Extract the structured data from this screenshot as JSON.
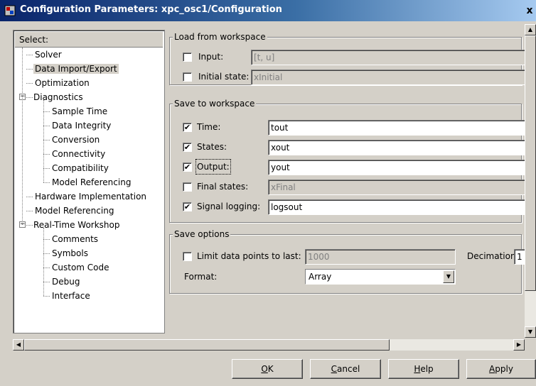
{
  "window": {
    "title": "Configuration Parameters: xpc_osc1/Configuration",
    "close_label": "x"
  },
  "tree": {
    "header": "Select:",
    "items": [
      {
        "label": "Solver",
        "level": 1
      },
      {
        "label": "Data Import/Export",
        "level": 1,
        "selected": true
      },
      {
        "label": "Optimization",
        "level": 1
      },
      {
        "label": "Diagnostics",
        "level": 0,
        "expander": "−"
      },
      {
        "label": "Sample Time",
        "level": 2
      },
      {
        "label": "Data Integrity",
        "level": 2
      },
      {
        "label": "Conversion",
        "level": 2
      },
      {
        "label": "Connectivity",
        "level": 2
      },
      {
        "label": "Compatibility",
        "level": 2
      },
      {
        "label": "Model Referencing",
        "level": 2
      },
      {
        "label": "Hardware Implementation",
        "level": 1
      },
      {
        "label": "Model Referencing",
        "level": 1
      },
      {
        "label": "Real-Time Workshop",
        "level": 0,
        "expander": "−"
      },
      {
        "label": "Comments",
        "level": 2
      },
      {
        "label": "Symbols",
        "level": 2
      },
      {
        "label": "Custom Code",
        "level": 2
      },
      {
        "label": "Debug",
        "level": 2
      },
      {
        "label": "Interface",
        "level": 2
      }
    ]
  },
  "load": {
    "title": "Load from workspace",
    "input": {
      "label": "Input:",
      "checked": false,
      "value": "[t, u]"
    },
    "initial_state": {
      "label": "Initial state:",
      "checked": false,
      "value": "xInitial"
    }
  },
  "save": {
    "title": "Save to workspace",
    "time": {
      "label": "Time:",
      "checked": true,
      "value": "tout"
    },
    "states": {
      "label": "States:",
      "checked": true,
      "value": "xout"
    },
    "output": {
      "label": "Output:",
      "checked": true,
      "value": "yout"
    },
    "final_states": {
      "label": "Final states:",
      "checked": false,
      "value": "xFinal"
    },
    "signal_logging": {
      "label": "Signal logging:",
      "checked": true,
      "value": "logsout"
    }
  },
  "options": {
    "title": "Save options",
    "limit": {
      "label": "Limit data points to last:",
      "checked": false,
      "value": "1000"
    },
    "decimation": {
      "label": "Decimation:",
      "value": "1"
    },
    "format": {
      "label": "Format:",
      "value": "Array"
    }
  },
  "buttons": {
    "ok": {
      "accel": "O",
      "rest": "K"
    },
    "cancel": {
      "accel": "C",
      "rest": "ancel"
    },
    "help": {
      "accel": "H",
      "rest": "elp"
    },
    "apply": {
      "accel": "A",
      "rest": "pply"
    }
  },
  "colors": {
    "title_active": "#0a246a",
    "face": "#d4d0c8"
  }
}
